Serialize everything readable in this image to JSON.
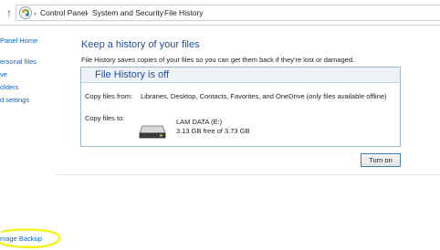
{
  "breadcrumb": {
    "items": [
      "Control Panel",
      "System and Security",
      "File History"
    ],
    "separator": "›"
  },
  "icons": {
    "up": "up-arrow-icon",
    "control_panel": "control-panel-icon",
    "drive": "hard-drive-icon"
  },
  "sidebar": {
    "home": "Panel Home",
    "items": [
      "ersonal files",
      "ve",
      "olders",
      "d settings"
    ],
    "bottom_link": "mage Backup"
  },
  "main": {
    "title": "Keep a history of your files",
    "description": "File History saves copies of your files so you can get them back if they're lost or damaged.",
    "status": "File History is off",
    "copy_from_label": "Copy files from:",
    "copy_from_value": "Libraries, Desktop, Contacts, Favorites, and OneDrive (only files available offline)",
    "copy_to_label": "Copy files to:",
    "drive_name": "LAM DATA (E:)",
    "drive_space": "3.13 GB free of 3.73 GB",
    "turn_on_button": "Turn on"
  },
  "colors": {
    "title": "#1f4e99",
    "link": "#0066cc",
    "annotation_highlight": "#f5f21c",
    "button_border": "#3c7fb1"
  }
}
